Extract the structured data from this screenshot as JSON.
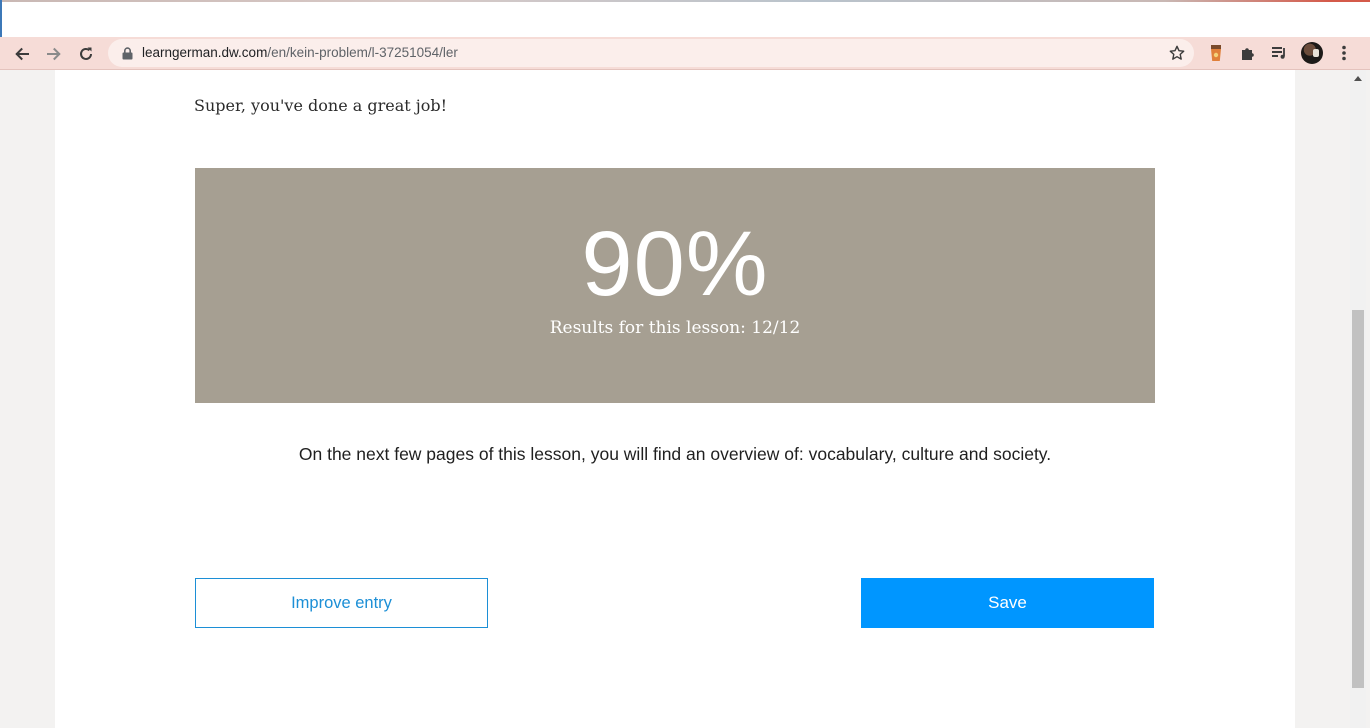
{
  "browser": {
    "url_host": "learngerman.dw.com",
    "url_path": "/en/kein-problem/l-37251054/ler",
    "icons": {
      "back": "arrow-left-icon",
      "forward": "arrow-right-icon",
      "reload": "reload-icon",
      "lock": "lock-icon",
      "bookmark": "star-icon",
      "extension_1": "coffee-extension-icon",
      "extensions": "puzzle-icon",
      "media": "media-queue-icon",
      "profile": "avatar",
      "menu": "kebab-menu-icon"
    }
  },
  "content": {
    "greeting": "Super, you've done a great job!",
    "score_percent": "90%",
    "result_line": "Results for this lesson: 12/12",
    "overview_text": "On the next few pages of this lesson, you will find an overview of: vocabulary, culture and society.",
    "improve_button_label": "Improve entry",
    "save_button_label": "Save"
  },
  "colors": {
    "result_box": "#a69f92",
    "primary_button": "#0096ff",
    "outline_button": "#1c8fd6",
    "toolbar": "#f6dcd7"
  }
}
